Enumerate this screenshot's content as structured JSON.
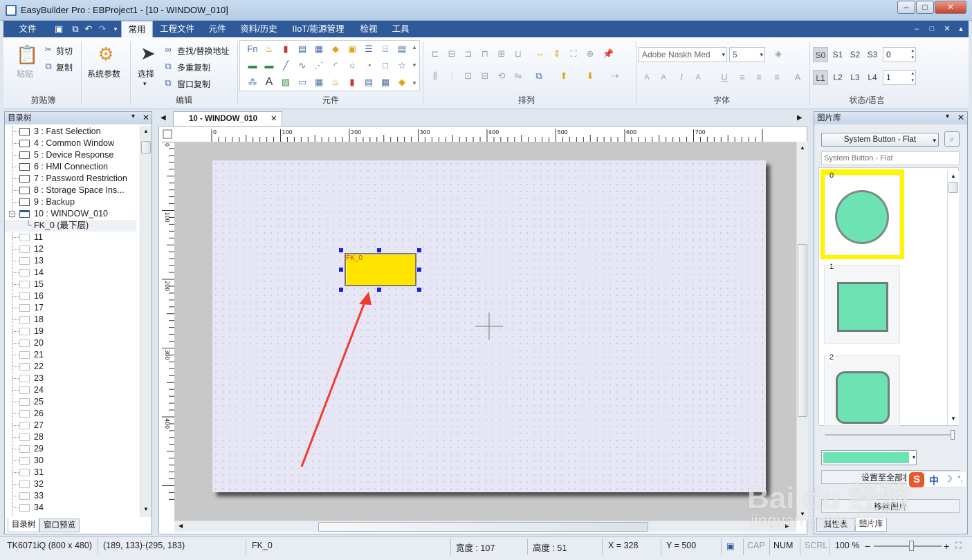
{
  "window": {
    "title": "EasyBuilder Pro : EBProject1 - [10 - WINDOW_010]",
    "min": "–",
    "max": "□",
    "close": "✕"
  },
  "menu": {
    "file": "文件",
    "tabs": [
      "常用",
      "工程文件",
      "元件",
      "资料/历史",
      "IIoT/能源管理",
      "检视",
      "工具"
    ],
    "mdi": [
      "–",
      "□",
      "✕",
      "▴"
    ]
  },
  "ribbon": {
    "clipboard": {
      "paste": "粘贴",
      "cut": "剪切",
      "copy": "复制",
      "label": "剪贴簿"
    },
    "system_params": "系统参数",
    "edit": {
      "select": "选择",
      "find_replace": "查找/替换地址",
      "multi_copy": "多重复制",
      "window_copy": "窗口复制",
      "label": "编辑"
    },
    "objects_label": "元件",
    "arrange_label": "排列",
    "font": {
      "name": "Adobe Naskh Med",
      "size": "5",
      "label": "字体"
    },
    "state": {
      "s_buttons": [
        "S0",
        "S1",
        "S2",
        "S3"
      ],
      "s_value": "0",
      "l_buttons": [
        "L1",
        "L2",
        "L3",
        "L4"
      ],
      "l_value": "1",
      "label": "状态/语言"
    }
  },
  "tree": {
    "title": "目录树",
    "items": [
      {
        "label": "3 : Fast Selection",
        "light": false
      },
      {
        "label": "4 : Common Window",
        "light": false
      },
      {
        "label": "5 : Device Response",
        "light": false
      },
      {
        "label": "6 : HMI Connection",
        "light": false
      },
      {
        "label": "7 : Password Restriction",
        "light": false
      },
      {
        "label": "8 : Storage Space Ins...",
        "light": false
      },
      {
        "label": "9 : Backup",
        "light": false
      },
      {
        "label": "10 : WINDOW_010",
        "light": false
      },
      {
        "label": "FK_0 (最下层)",
        "light": false
      },
      {
        "label": "11",
        "light": true
      },
      {
        "label": "12",
        "light": true
      },
      {
        "label": "13",
        "light": true
      },
      {
        "label": "14",
        "light": true
      },
      {
        "label": "15",
        "light": true
      },
      {
        "label": "16",
        "light": true
      },
      {
        "label": "17",
        "light": true
      },
      {
        "label": "18",
        "light": true
      },
      {
        "label": "19",
        "light": true
      },
      {
        "label": "20",
        "light": true
      },
      {
        "label": "21",
        "light": true
      },
      {
        "label": "22",
        "light": true
      },
      {
        "label": "23",
        "light": true
      },
      {
        "label": "24",
        "light": true
      },
      {
        "label": "25",
        "light": true
      },
      {
        "label": "26",
        "light": true
      },
      {
        "label": "27",
        "light": true
      },
      {
        "label": "28",
        "light": true
      },
      {
        "label": "29",
        "light": true
      },
      {
        "label": "30",
        "light": true
      },
      {
        "label": "31",
        "light": true
      },
      {
        "label": "32",
        "light": true
      },
      {
        "label": "33",
        "light": true
      },
      {
        "label": "34",
        "light": true
      }
    ],
    "tabs": [
      "目录树",
      "窗口预览"
    ]
  },
  "editor": {
    "tab": "10 - WINDOW_010",
    "ruler_h": [
      "0",
      "100",
      "200",
      "300",
      "400",
      "500",
      "600",
      "700"
    ],
    "ruler_v": [
      "0",
      "100",
      "200",
      "300",
      "400"
    ],
    "object_label": "FK_0"
  },
  "library": {
    "title": "图片库",
    "dropdown": "System Button - Flat",
    "path": "System Button - Flat",
    "items": [
      "0",
      "1",
      "2"
    ],
    "set_all": "设置至全部状态",
    "remove": "移除图片",
    "tabs": [
      "属性表",
      "图片库"
    ]
  },
  "watermark": {
    "brand": "Bai du 经验",
    "url": "jingyan.baidu.com",
    "ime": "中"
  },
  "status": {
    "model": "TK6071iQ (800 x 480)",
    "coords": "(189, 133)-(295, 183)",
    "object": "FK_0",
    "width": "宽度 : 107",
    "height": "高度 :  51",
    "x": "X = 328",
    "y": "Y = 500",
    "cap": "CAP",
    "num": "NUM",
    "scrl": "SCRL",
    "zoom": "100 %",
    "zoom_level": 0.55
  }
}
